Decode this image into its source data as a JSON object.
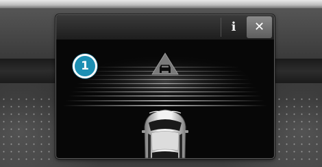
{
  "panel": {
    "info_label": "i",
    "close_label": "✕"
  },
  "callout": {
    "number": "1"
  },
  "colors": {
    "callout_fill": "#1c8fb3",
    "warning_triangle": "#7a7a7a",
    "panel_background": "#070707"
  },
  "icons": {
    "info": "info-icon",
    "close": "close-icon",
    "warning": "vehicle-warning-icon",
    "vehicle": "own-vehicle-icon"
  }
}
